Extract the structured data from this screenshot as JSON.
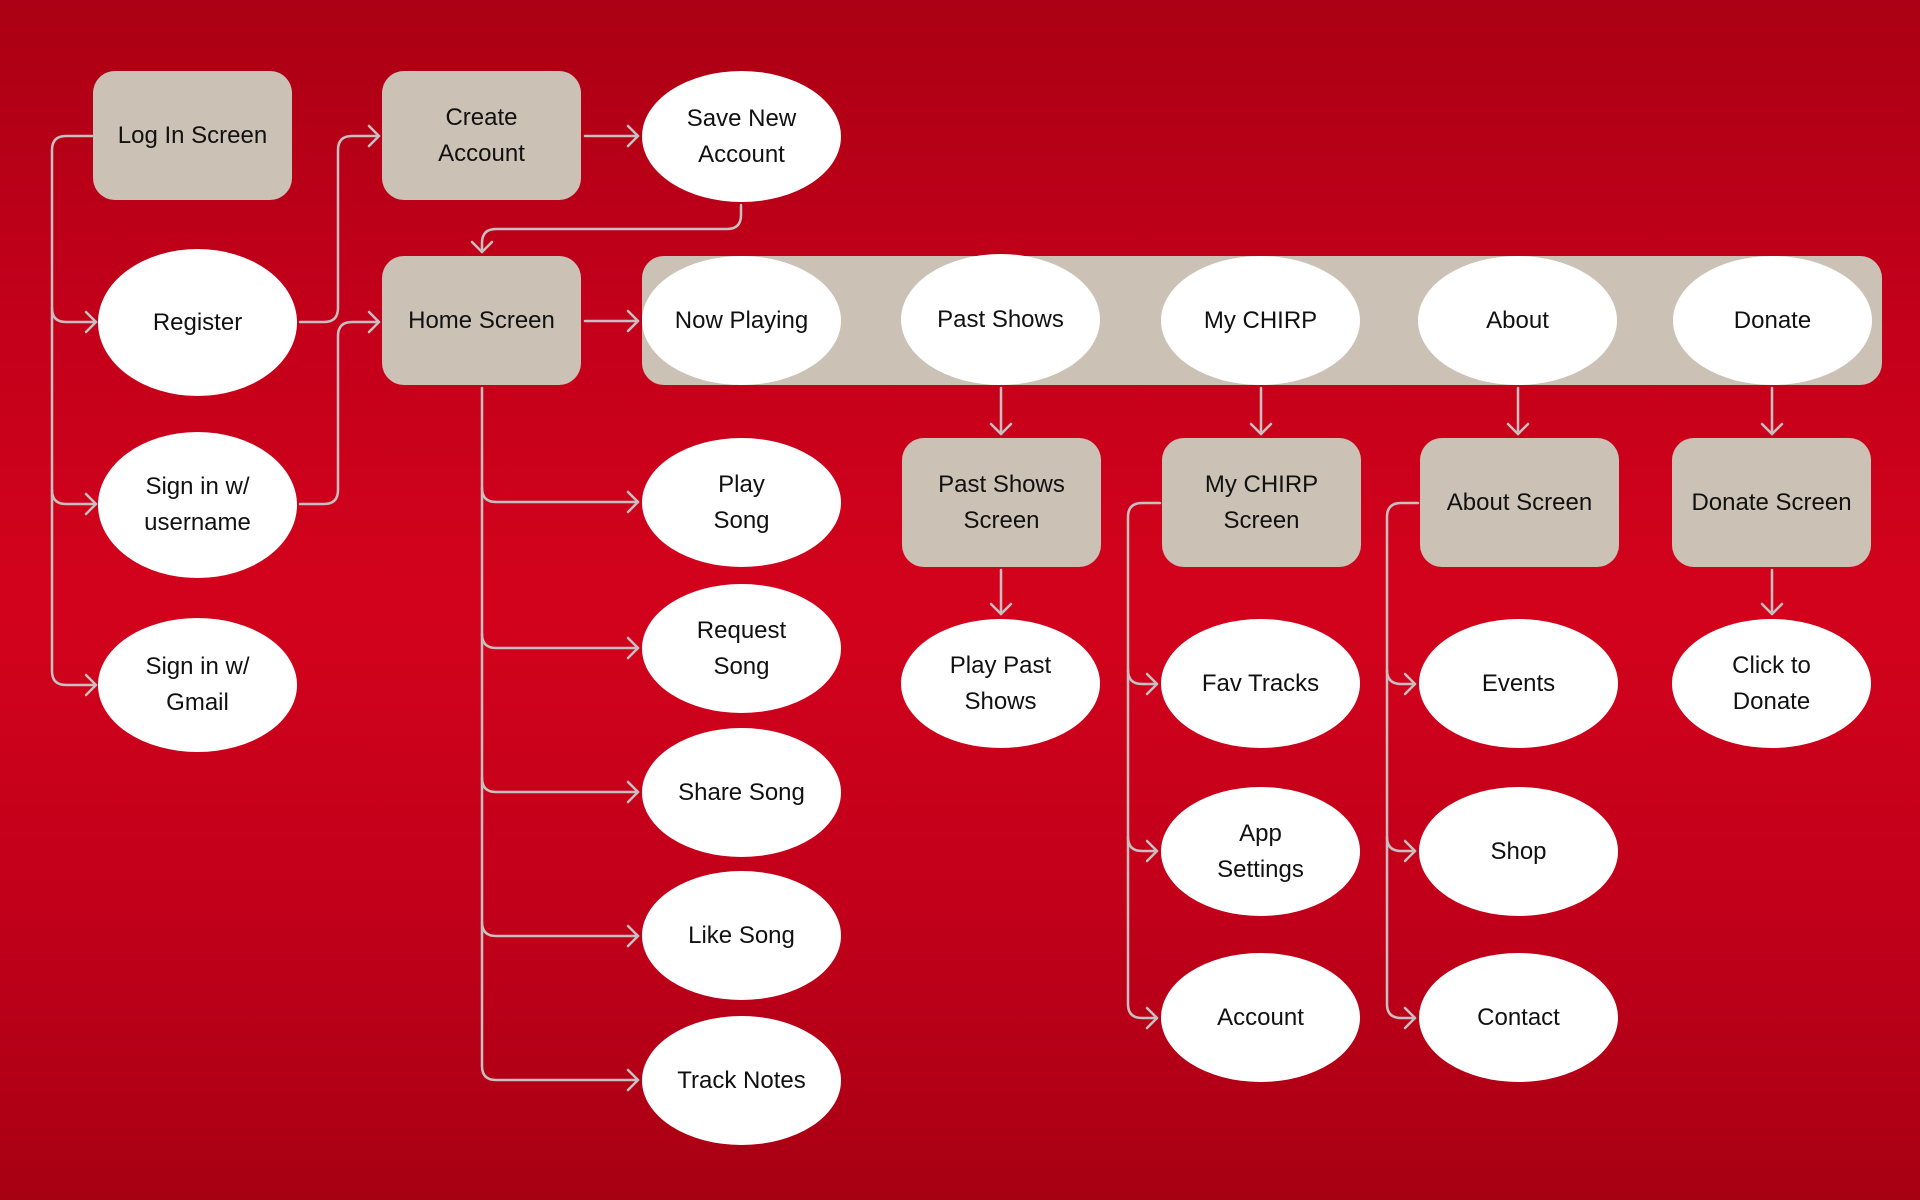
{
  "diagram": {
    "title": "",
    "colors": {
      "background": "#d3021c",
      "screen_box": "#cbc1b5",
      "action_oval": "#ffffff",
      "connector": "#c8c0c0",
      "text": "#111111"
    },
    "nodes": {
      "login": {
        "label": "Log In Screen",
        "shape": "box"
      },
      "create_account": {
        "label": "Create\nAccount",
        "shape": "box"
      },
      "save_new_account": {
        "label": "Save New\nAccount",
        "shape": "oval"
      },
      "register": {
        "label": "Register",
        "shape": "oval"
      },
      "signin_username": {
        "label": "Sign in w/\nusername",
        "shape": "oval"
      },
      "signin_gmail": {
        "label": "Sign in w/\nGmail",
        "shape": "oval"
      },
      "home": {
        "label": "Home Screen",
        "shape": "box"
      },
      "nav_now_playing": {
        "label": "Now Playing",
        "shape": "oval"
      },
      "nav_past_shows": {
        "label": "Past Shows",
        "shape": "oval"
      },
      "nav_my_chirp": {
        "label": "My CHIRP",
        "shape": "oval"
      },
      "nav_about": {
        "label": "About",
        "shape": "oval"
      },
      "nav_donate": {
        "label": "Donate",
        "shape": "oval"
      },
      "play_song": {
        "label": "Play\nSong",
        "shape": "oval"
      },
      "request_song": {
        "label": "Request\nSong",
        "shape": "oval"
      },
      "share_song": {
        "label": "Share Song",
        "shape": "oval"
      },
      "like_song": {
        "label": "Like Song",
        "shape": "oval"
      },
      "track_notes": {
        "label": "Track Notes",
        "shape": "oval"
      },
      "past_shows_screen": {
        "label": "Past Shows\nScreen",
        "shape": "box"
      },
      "my_chirp_screen": {
        "label": "My CHIRP\nScreen",
        "shape": "box"
      },
      "about_screen": {
        "label": "About Screen",
        "shape": "box"
      },
      "donate_screen": {
        "label": "Donate Screen",
        "shape": "box"
      },
      "play_past_shows": {
        "label": "Play Past\nShows",
        "shape": "oval"
      },
      "fav_tracks": {
        "label": "Fav Tracks",
        "shape": "oval"
      },
      "app_settings": {
        "label": "App\nSettings",
        "shape": "oval"
      },
      "account": {
        "label": "Account",
        "shape": "oval"
      },
      "events": {
        "label": "Events",
        "shape": "oval"
      },
      "shop": {
        "label": "Shop",
        "shape": "oval"
      },
      "contact": {
        "label": "Contact",
        "shape": "oval"
      },
      "click_to_donate": {
        "label": "Click to\nDonate",
        "shape": "oval"
      }
    },
    "edges": [
      [
        "login",
        "register"
      ],
      [
        "login",
        "signin_username"
      ],
      [
        "login",
        "signin_gmail"
      ],
      [
        "register",
        "create_account"
      ],
      [
        "create_account",
        "save_new_account"
      ],
      [
        "save_new_account",
        "home"
      ],
      [
        "signin_username",
        "home"
      ],
      [
        "home",
        "nav_now_playing"
      ],
      [
        "home",
        "play_song"
      ],
      [
        "home",
        "request_song"
      ],
      [
        "home",
        "share_song"
      ],
      [
        "home",
        "like_song"
      ],
      [
        "home",
        "track_notes"
      ],
      [
        "nav_past_shows",
        "past_shows_screen"
      ],
      [
        "past_shows_screen",
        "play_past_shows"
      ],
      [
        "nav_my_chirp",
        "my_chirp_screen"
      ],
      [
        "my_chirp_screen",
        "fav_tracks"
      ],
      [
        "my_chirp_screen",
        "app_settings"
      ],
      [
        "my_chirp_screen",
        "account"
      ],
      [
        "nav_about",
        "about_screen"
      ],
      [
        "about_screen",
        "events"
      ],
      [
        "about_screen",
        "shop"
      ],
      [
        "about_screen",
        "contact"
      ],
      [
        "nav_donate",
        "donate_screen"
      ],
      [
        "donate_screen",
        "click_to_donate"
      ]
    ]
  }
}
